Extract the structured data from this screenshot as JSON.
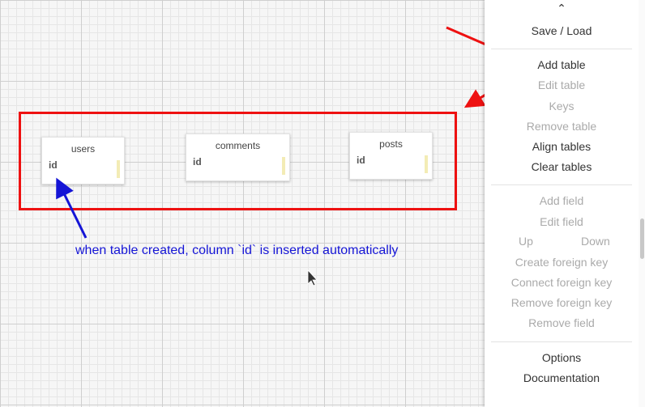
{
  "tables": [
    {
      "name": "users",
      "field": "id"
    },
    {
      "name": "comments",
      "field": "id"
    },
    {
      "name": "posts",
      "field": "id"
    }
  ],
  "annotation": "when table created, column `id` is inserted automatically",
  "menu": {
    "collapse_icon": "caret-up-icon",
    "collapse_glyph": "⌃",
    "save_load": "Save / Load",
    "add_table": "Add table",
    "edit_table": "Edit table",
    "keys": "Keys",
    "remove_table": "Remove table",
    "align_tables": "Align tables",
    "clear_tables": "Clear tables",
    "add_field": "Add field",
    "edit_field": "Edit field",
    "up": "Up",
    "down": "Down",
    "create_foreign_key": "Create foreign key",
    "connect_foreign_key": "Connect foreign key",
    "remove_foreign_key": "Remove foreign key",
    "remove_field": "Remove field",
    "options": "Options",
    "documentation": "Documentation"
  },
  "colors": {
    "highlight_frame": "#ee1111",
    "annotation_arrow": "#1515d6",
    "menu_disabled": "#aaaaaa",
    "menu_enabled": "#333333"
  }
}
